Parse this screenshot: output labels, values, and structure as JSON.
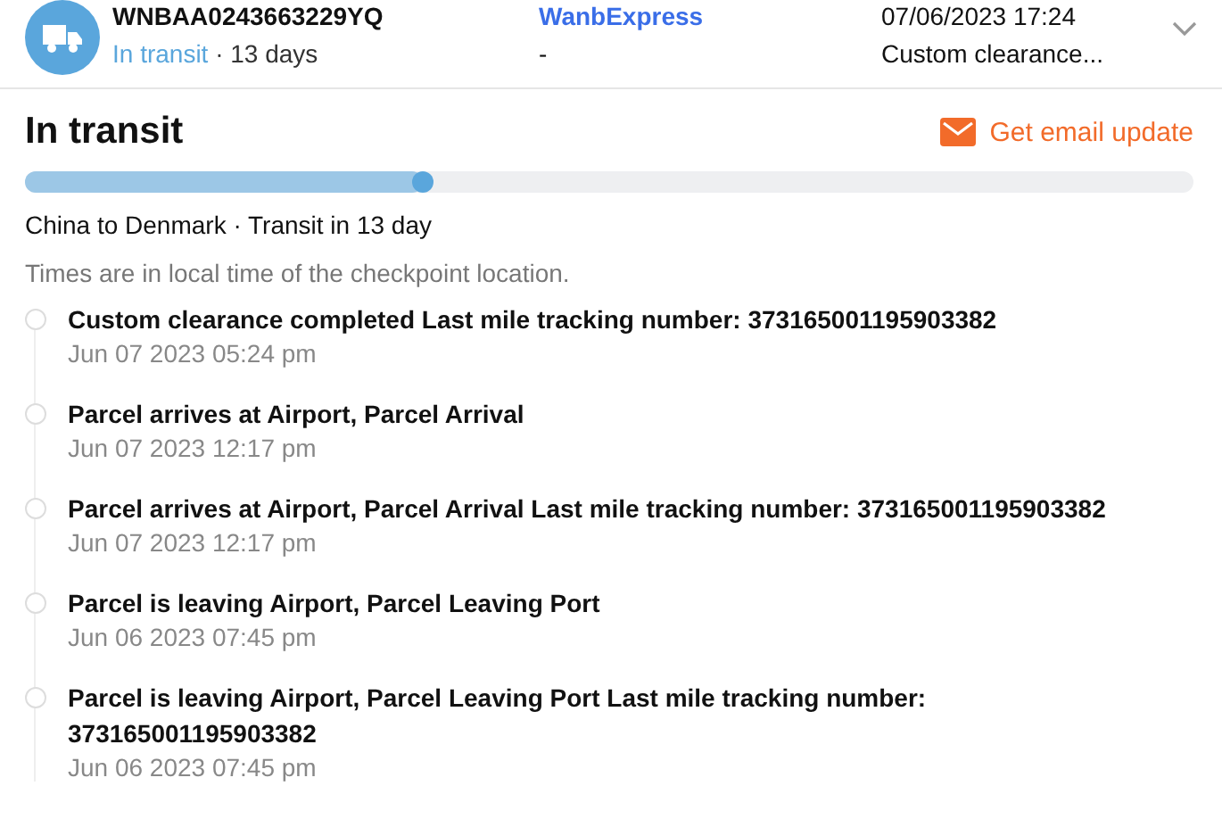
{
  "shipment": {
    "tracking_number": "WNBAA0243663229YQ",
    "status": "In transit",
    "duration": "· 13 days",
    "carrier": "WanbExpress",
    "carrier_detail": "-",
    "latest_time": "07/06/2023 17:24",
    "latest_event": "Custom clearance...",
    "expanded": true
  },
  "detail": {
    "title": "In transit",
    "email_button": "Get email update",
    "level": 0.34,
    "route": "China to Denmark · Transit in 13 day",
    "note": "Times are in local time of the checkpoint location."
  },
  "events": [
    {
      "title": "Custom clearance completed Last mile tracking number: 373165001195903382",
      "time": "Jun 07 2023 05:24 pm"
    },
    {
      "title": "Parcel arrives at Airport, Parcel Arrival",
      "time": "Jun 07 2023 12:17 pm"
    },
    {
      "title": "Parcel arrives at Airport, Parcel Arrival Last mile tracking number: 373165001195903382",
      "time": "Jun 07 2023 12:17 pm"
    },
    {
      "title": "Parcel is leaving Airport, Parcel Leaving Port",
      "time": "Jun 06 2023 07:45 pm"
    },
    {
      "title": "Parcel is leaving Airport, Parcel Leaving Port Last mile tracking number: 373165001195903382",
      "time": "Jun 06 2023 07:45 pm"
    }
  ]
}
